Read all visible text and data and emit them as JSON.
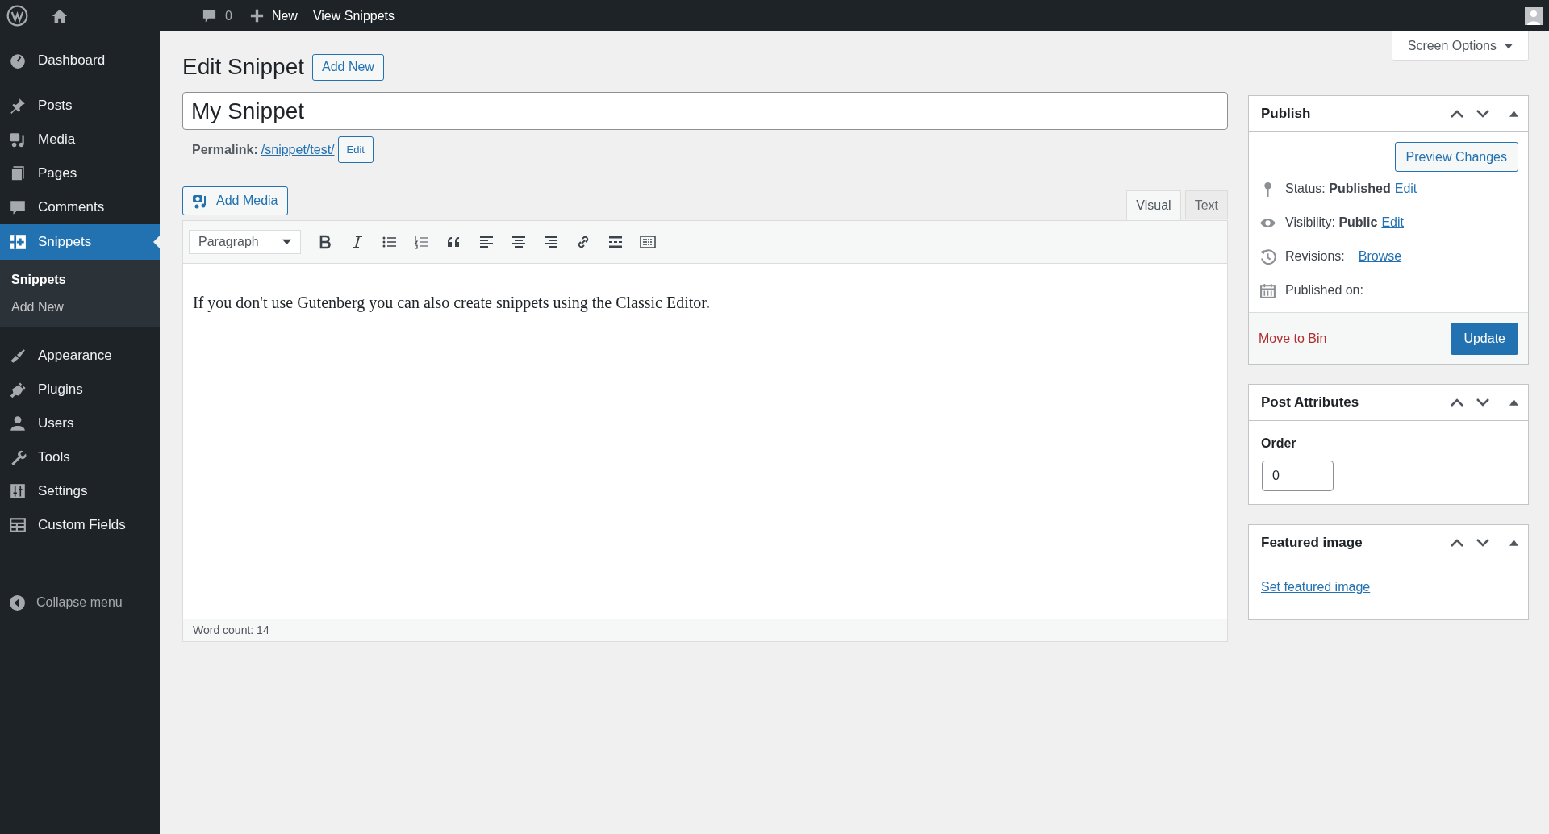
{
  "admin_bar": {
    "comments_count": "0",
    "new_label": "New",
    "view_label": "View Snippets"
  },
  "sidebar": {
    "items": [
      {
        "label": "Dashboard",
        "selected": false
      },
      {
        "label": "Posts",
        "selected": false
      },
      {
        "label": "Media",
        "selected": false
      },
      {
        "label": "Pages",
        "selected": false
      },
      {
        "label": "Comments",
        "selected": false
      },
      {
        "label": "Snippets",
        "selected": true,
        "children": [
          {
            "label": "Snippets",
            "selected": true
          },
          {
            "label": "Add New",
            "selected": false
          }
        ]
      },
      {
        "label": "Appearance",
        "selected": false
      },
      {
        "label": "Plugins",
        "selected": false
      },
      {
        "label": "Users",
        "selected": false
      },
      {
        "label": "Tools",
        "selected": false
      },
      {
        "label": "Settings",
        "selected": false
      },
      {
        "label": "Custom Fields",
        "selected": false
      }
    ],
    "collapse_label": "Collapse menu"
  },
  "screen_options": "Screen Options",
  "page_title": "Edit Snippet",
  "add_new": "Add New",
  "post_title": "My Snippet",
  "permalink": {
    "label": "Permalink:",
    "url": "/snippet/test/",
    "edit": "Edit"
  },
  "add_media": "Add Media",
  "editor_tabs": [
    {
      "label": "Visual",
      "selected": true
    },
    {
      "label": "Text",
      "selected": false
    }
  ],
  "format_select": "Paragraph",
  "content": "If you don't use Gutenberg you can also create snippets using the Classic Editor.",
  "word_count": "Word count: 14",
  "publish": {
    "title": "Publish",
    "preview": "Preview Changes",
    "rows": [
      {
        "label": "Status:",
        "value": "Published",
        "link": "Edit"
      },
      {
        "label": "Visibility:",
        "value": "Public",
        "link": "Edit"
      },
      {
        "label": "Revisions:",
        "link": "Browse"
      },
      {
        "label": "Published on:"
      }
    ],
    "trash": "Move to Bin",
    "update": "Update"
  },
  "post_attributes": {
    "title": "Post Attributes",
    "order_label": "Order",
    "order_value": "0"
  },
  "featured_image": {
    "title": "Featured image",
    "link": "Set featured image"
  }
}
